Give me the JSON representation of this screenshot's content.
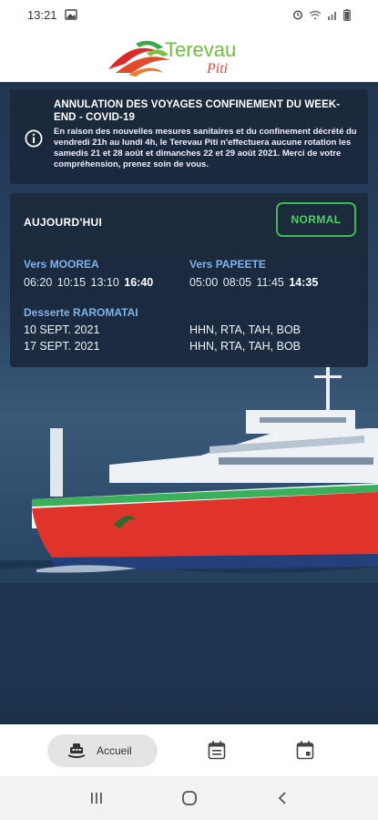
{
  "status_bar": {
    "time": "13:21"
  },
  "header": {
    "logo_title": "Terevau",
    "logo_subtitle": "Piti"
  },
  "alert": {
    "title": "ANNULATION DES VOYAGES CONFINEMENT DU WEEK-END - COVID-19",
    "body": "En raison des nouvelles mesures sanitaires et du confinement décrété du vendredi 21h au lundi 4h, le Terevau Piti n'effectuera aucune rotation les samedis 21 et 28 août et dimanches 22 et 29 août 2021. Merci de votre compréhension, prenez soin de vous."
  },
  "today": {
    "label": "AUJOURD'HUI",
    "status": "NORMAL",
    "moorea": {
      "heading": "Vers MOOREA",
      "times": "06:20 10:15 13:10",
      "next": "16:40"
    },
    "papeete": {
      "heading": "Vers PAPEETE",
      "times": "05:00 08:05 11:45",
      "next": "14:35"
    },
    "raromatai": {
      "heading": "Desserte RAROMATAI",
      "rows": [
        {
          "date": "10 SEPT. 2021",
          "stops": "HHN, RTA, TAH, BOB"
        },
        {
          "date": "17 SEPT. 2021",
          "stops": "HHN, RTA, TAH, BOB"
        }
      ]
    }
  },
  "bottom_nav": {
    "home_label": "Accueil"
  },
  "colors": {
    "accent_green": "#3dbb50",
    "link_blue": "#7fb2ea",
    "panel": "#1b283c"
  }
}
